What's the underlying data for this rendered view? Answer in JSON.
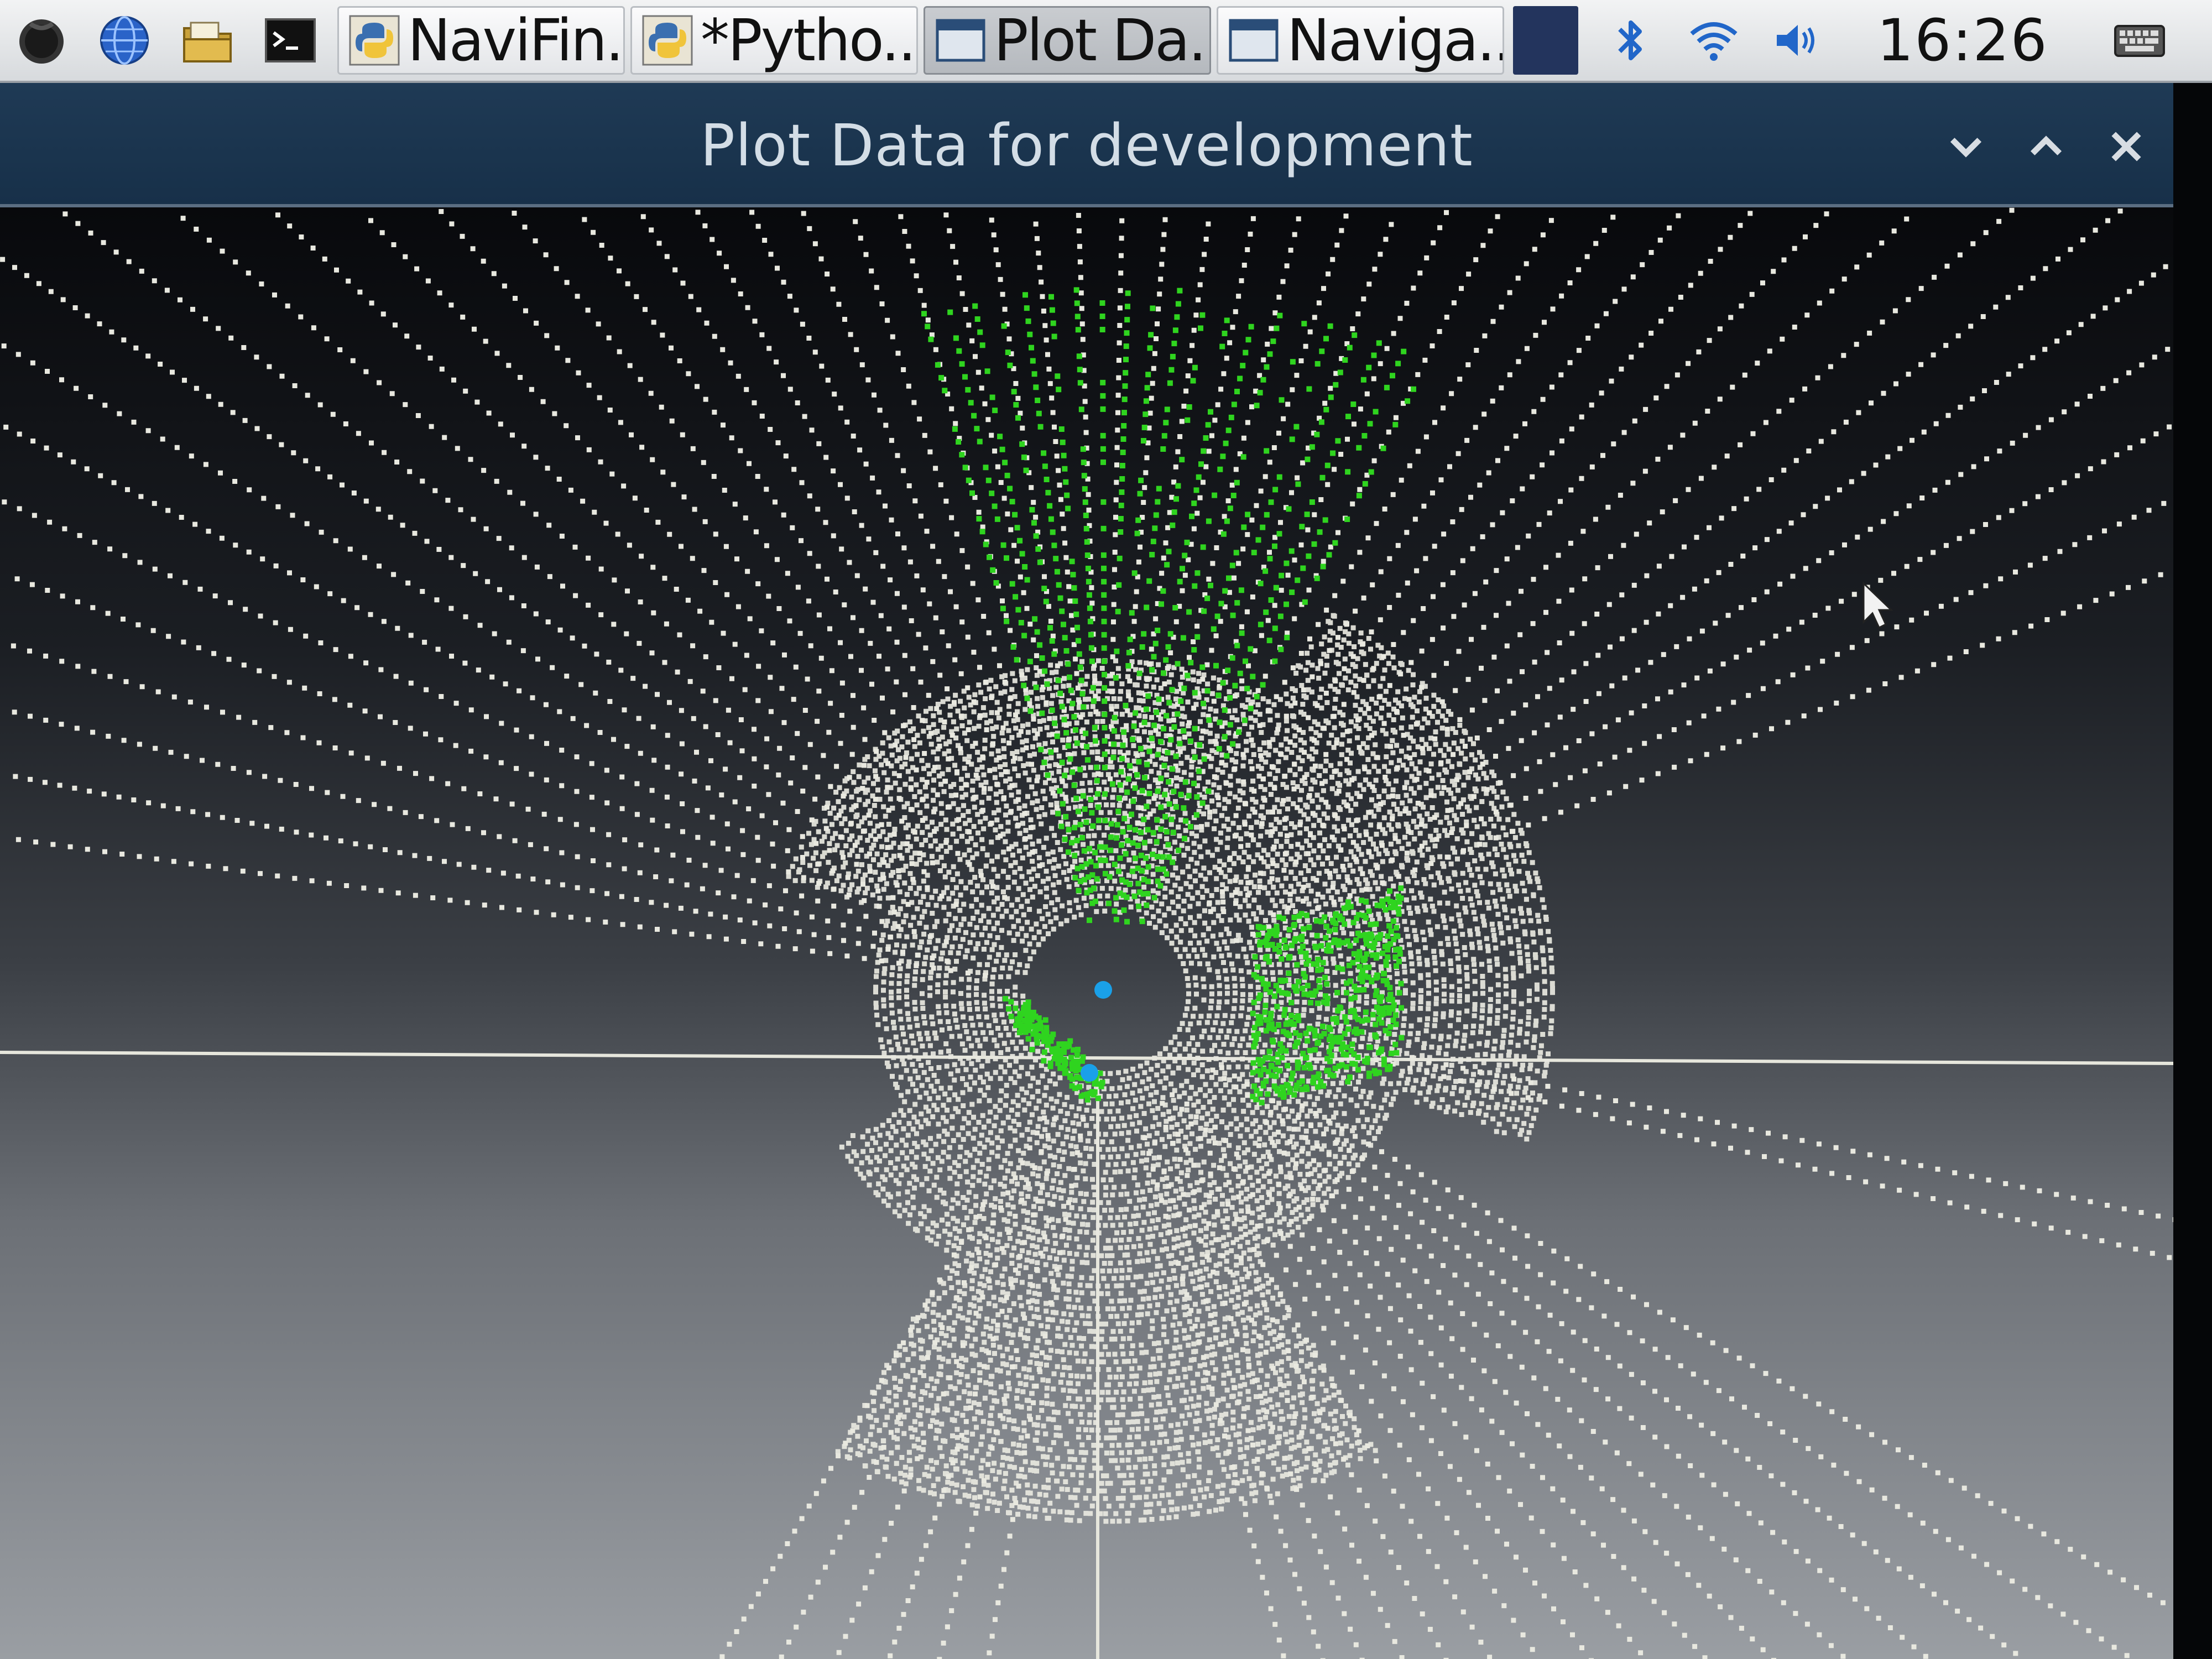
{
  "taskbar": {
    "launchers": [
      {
        "name": "menu-icon"
      },
      {
        "name": "web-browser-icon"
      },
      {
        "name": "file-manager-icon"
      },
      {
        "name": "terminal-icon"
      }
    ],
    "tasks": [
      {
        "label": "NaviFin...",
        "icon": "python-icon",
        "active": false
      },
      {
        "label": "*Pytho...",
        "icon": "python-icon",
        "active": false
      },
      {
        "label": "Plot Da...",
        "icon": "window-icon",
        "active": true
      },
      {
        "label": "Naviga...",
        "icon": "window-icon",
        "active": false
      }
    ],
    "tray": {
      "icons": [
        "bluetooth-icon",
        "wifi-icon",
        "volume-icon",
        "keyboard-icon"
      ],
      "clock": "16:26"
    }
  },
  "window": {
    "title": "Plot Data for development",
    "controls": [
      "minimize-icon",
      "maximize-icon",
      "close-icon"
    ]
  },
  "plot": {
    "colors": {
      "point": "#e8e8df",
      "highlight": "#2fd41f",
      "marker": "#1aa0e8",
      "axis": "#e6e6dc"
    },
    "markers": [
      {
        "name": "robot-position-marker"
      },
      {
        "name": "target-position-marker"
      }
    ]
  }
}
